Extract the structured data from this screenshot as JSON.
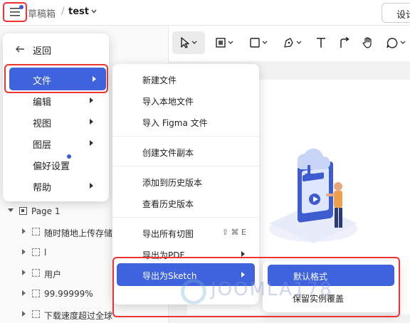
{
  "header": {
    "breadcrumb_drafts": "草稿箱",
    "breadcrumb_separator": "/",
    "file_name": "test",
    "right_button": "设计"
  },
  "toolbar": {
    "tools": [
      "move-tool",
      "frame-tool",
      "rectangle-tool",
      "pen-tool",
      "text-tool",
      "connector-tool",
      "hand-tool",
      "comment-tool"
    ]
  },
  "main_menu": {
    "back_label": "返回",
    "items": [
      {
        "label": "文件",
        "has_submenu": true,
        "active": true
      },
      {
        "label": "编辑",
        "has_submenu": true
      },
      {
        "label": "视图",
        "has_submenu": true
      },
      {
        "label": "图层",
        "has_submenu": true
      },
      {
        "label": "偏好设置",
        "has_submenu": false,
        "badge": true
      },
      {
        "label": "帮助",
        "has_submenu": true
      }
    ]
  },
  "file_menu": {
    "items": [
      {
        "label": "新建文件"
      },
      {
        "label": "导入本地文件"
      },
      {
        "label": "导入 Figma 文件"
      },
      {
        "label": "创建文件副本"
      },
      {
        "label": "添加到历史版本"
      },
      {
        "label": "查看历史版本"
      },
      {
        "label": "导出所有切图",
        "shortcut": "⇧ ⌘ E"
      },
      {
        "label": "导出为PDF",
        "has_submenu": true
      },
      {
        "label": "导出为Sketch",
        "has_submenu": true,
        "active": true
      }
    ]
  },
  "sketch_menu": {
    "items": [
      {
        "label": "默认格式",
        "active": true
      },
      {
        "label": "保留实例覆盖"
      }
    ]
  },
  "layers": {
    "page_name": "Page 1",
    "items": [
      {
        "label": "随时随地上传存储"
      },
      {
        "label": "l"
      },
      {
        "label": "用户"
      },
      {
        "label": "99.99999%"
      },
      {
        "label": "下载速度超过全球"
      }
    ]
  },
  "watermark": {
    "text": "JOOMLA178"
  },
  "colors": {
    "accent": "#3e63dd",
    "highlight_box": "#e33333",
    "badge": "#3b5bdb"
  }
}
